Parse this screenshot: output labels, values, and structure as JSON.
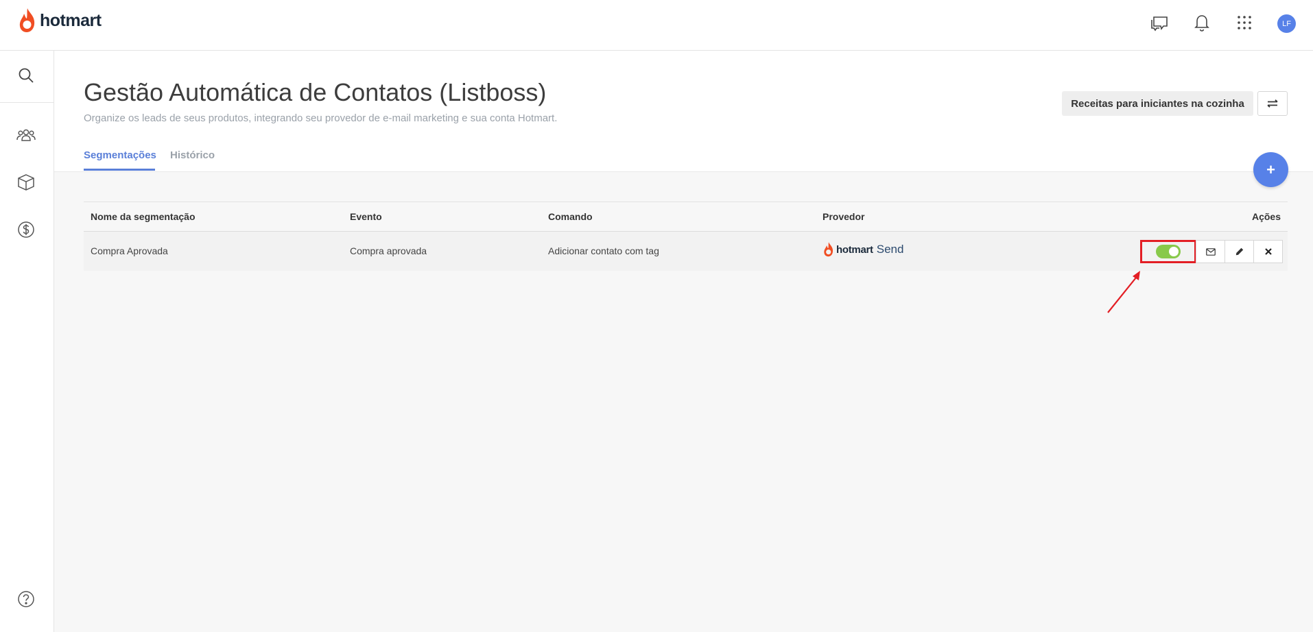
{
  "brand": {
    "name": "hotmart"
  },
  "topbar": {
    "icons": [
      "chat-icon",
      "bell-icon",
      "apps-grid-icon"
    ],
    "avatar_initials": "LF"
  },
  "sidebar": {
    "items": [
      "search-icon",
      "users-icon",
      "box-icon",
      "dollar-icon",
      "help-icon"
    ]
  },
  "page": {
    "title": "Gestão Automática de Contatos (Listboss)",
    "subtitle": "Organize os leads de seus produtos, integrando seu provedor de e-mail marketing e sua conta Hotmart.",
    "product_button": "Receitas para iniciantes na cozinha",
    "fab_label": "+"
  },
  "tabs": [
    {
      "label": "Segmentações",
      "active": true
    },
    {
      "label": "Histórico",
      "active": false
    }
  ],
  "table": {
    "headers": [
      "Nome da segmentação",
      "Evento",
      "Comando",
      "Provedor",
      "Ações"
    ],
    "rows": [
      {
        "name": "Compra Aprovada",
        "event": "Compra aprovada",
        "command": "Adicionar contato com tag",
        "provider_brand": "hotmart",
        "provider_product": "Send",
        "enabled": true
      }
    ]
  },
  "colors": {
    "accent": "#5a7fd8",
    "fab": "#5781e8",
    "toggle_on": "#88c94a",
    "highlight": "#e31e24",
    "brand_flame": "#f04e23"
  }
}
